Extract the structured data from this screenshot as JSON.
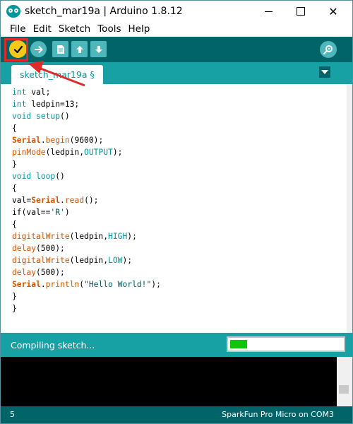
{
  "window": {
    "title": "sketch_mar19a | Arduino 1.8.12"
  },
  "window_controls": {
    "minimize": "",
    "maximize": "",
    "close": "✕"
  },
  "menu": [
    "File",
    "Edit",
    "Sketch",
    "Tools",
    "Help"
  ],
  "toolbar": {
    "buttons": [
      "verify-icon",
      "upload-icon",
      "new-icon",
      "open-icon",
      "save-icon",
      "serial-monitor-icon"
    ]
  },
  "tab": {
    "label": "sketch_mar19a §"
  },
  "code_lines": [
    "int val;",
    "int ledpin=13;",
    "void setup()",
    "{",
    "Serial.begin(9600);",
    "pinMode(ledpin,OUTPUT);",
    "}",
    "void loop()",
    "{",
    "val=Serial.read();",
    "if(val=='R')",
    "{",
    "digitalWrite(ledpin,HIGH);",
    "delay(500);",
    "digitalWrite(ledpin,LOW);",
    "delay(500);",
    "Serial.println(\"Hello World!\");",
    "}",
    "}"
  ],
  "status": {
    "message": "Compiling sketch...",
    "progress": 0.15
  },
  "footer": {
    "line": "5",
    "board": "SparkFun Pro Micro on COM3"
  },
  "colors": {
    "toolbar": "#006468",
    "accent": "#17a1a5",
    "verify": "#f3c81a",
    "progress": "#12c40f",
    "annotation": "#e02a2a"
  }
}
